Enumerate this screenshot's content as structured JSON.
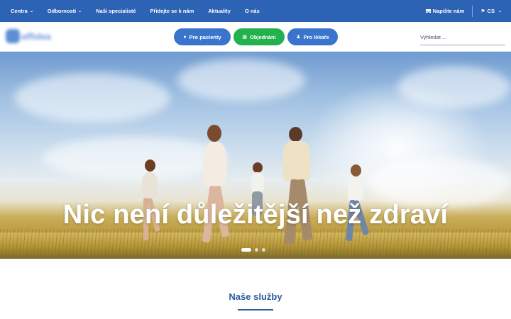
{
  "topnav": {
    "items": [
      {
        "label": "Centra",
        "dropdown": true
      },
      {
        "label": "Odbornosti",
        "dropdown": true
      },
      {
        "label": "Naši specialisté",
        "dropdown": false
      },
      {
        "label": "Přidejte se k nám",
        "dropdown": false
      },
      {
        "label": "Aktuality",
        "dropdown": false
      },
      {
        "label": "O nás",
        "dropdown": false
      }
    ],
    "contact_label": "Napište nám",
    "contact_icon": "envelope-icon",
    "language": "CS",
    "language_icon": "flag-icon",
    "background_color": "#2d63b4"
  },
  "header": {
    "logo_text": "affidea",
    "buttons": {
      "patients": {
        "label": "Pro pacienty",
        "icon": "info-icon",
        "color": "#3a74cc"
      },
      "order": {
        "label": "Objednání",
        "icon": "calendar-icon",
        "color": "#22b14c"
      },
      "doctors": {
        "label": "Pro lékaře",
        "icon": "doctor-icon",
        "color": "#3a74cc"
      }
    },
    "search_placeholder": "Vyhledat ..."
  },
  "hero": {
    "title": "Nic není důležitější než zdraví",
    "slides": 3,
    "active_slide": 1
  },
  "services": {
    "title": "Naše služby"
  }
}
